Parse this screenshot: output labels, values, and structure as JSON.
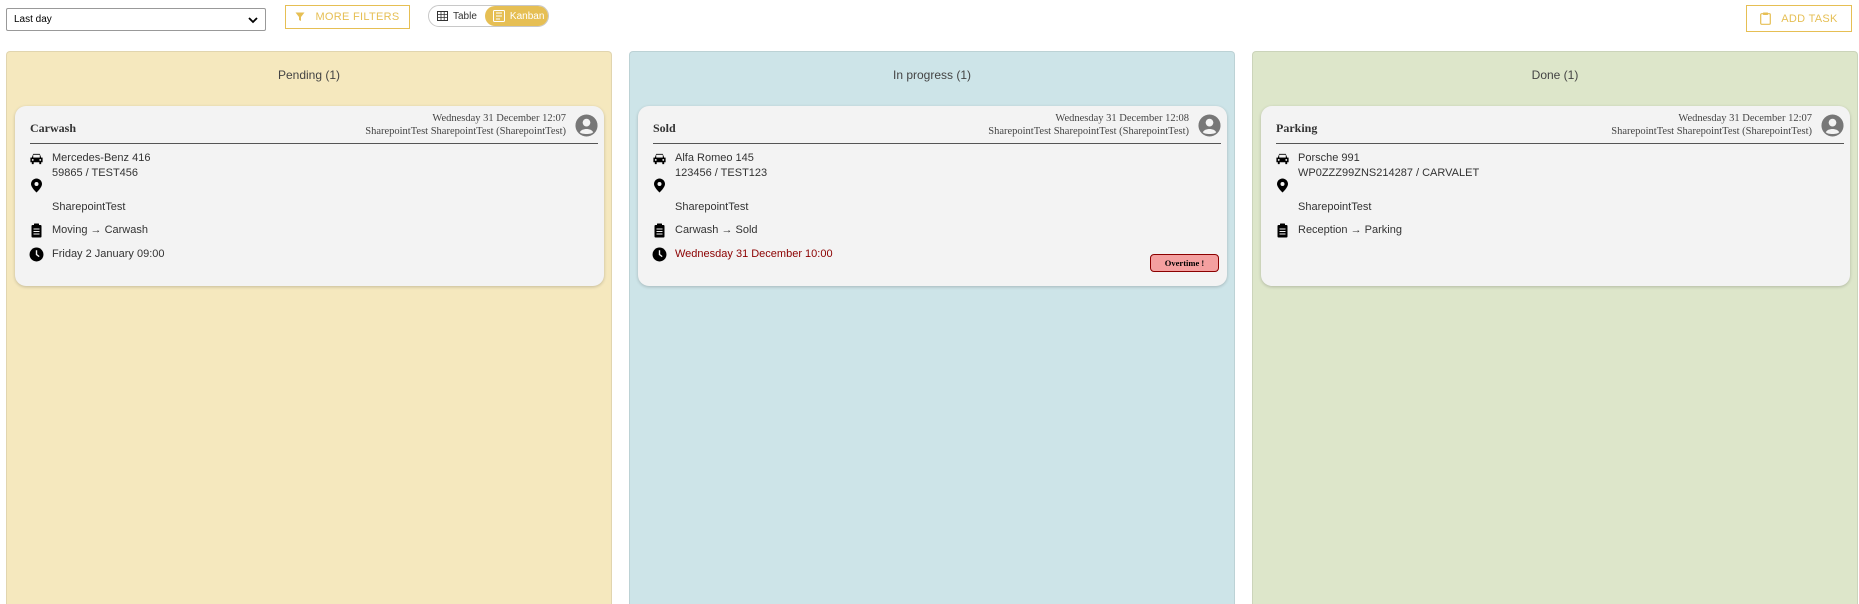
{
  "toolbar": {
    "period_select": {
      "value": "Last day"
    },
    "more_filters_label": "MORE FILTERS",
    "view_toggle": {
      "table_label": "Table",
      "kanban_label": "Kanban",
      "active": "kanban"
    },
    "add_task_label": "ADD TASK",
    "accent_color": "#e6bf54"
  },
  "columns": [
    {
      "title": "Pending (1)",
      "color": "#f5e8be",
      "cards": [
        {
          "title": "Carwash",
          "date": "Wednesday 31 December 12:07",
          "user": "SharepointTest SharepointTest (SharepointTest)",
          "vehicle": "Mercedes-Benz 416",
          "plate": "59865 / TEST456",
          "location": "SharepointTest",
          "task": "Moving → Carwash",
          "due": "Friday 2 January 09:00"
        }
      ]
    },
    {
      "title": "In progress (1)",
      "color": "#cde4e8",
      "cards": [
        {
          "title": "Sold",
          "date": "Wednesday 31 December 12:08",
          "user": "SharepointTest SharepointTest (SharepointTest)",
          "vehicle": "Alfa Romeo 145",
          "plate": "123456 / TEST123",
          "location": "SharepointTest",
          "task": "Carwash → Sold",
          "due": "Wednesday 31 December 10:00",
          "badge": "Overtime !",
          "overdue_color": "#8b0000"
        }
      ]
    },
    {
      "title": "Done (1)",
      "color": "#dde6ca",
      "cards": [
        {
          "title": "Parking",
          "date": "Wednesday 31 December 12:07",
          "user": "SharepointTest SharepointTest (SharepointTest)",
          "vehicle": "Porsche 991",
          "plate": "WP0ZZZ99ZNS214287 / CARVALET",
          "location": "SharepointTest",
          "task": "Reception → Parking"
        }
      ]
    }
  ]
}
